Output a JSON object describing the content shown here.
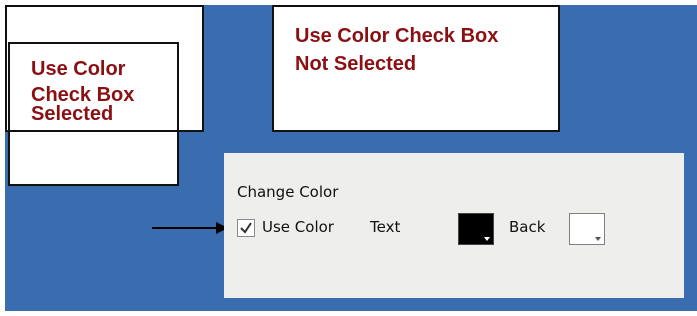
{
  "callouts": {
    "selected_line1": "Use Color",
    "selected_line2": "Check Box",
    "selected_line3": "Selected",
    "not_selected_line1": "Use Color Check Box",
    "not_selected_line2": "Not Selected"
  },
  "panel": {
    "group_title": "Change Color",
    "use_color_label": "Use Color",
    "use_color_checked": true,
    "text_label": "Text",
    "text_color": "#000000",
    "back_label": "Back",
    "back_color": "#ffffff"
  },
  "colors": {
    "background": "#3a6db0",
    "callout_text": "#8b1014",
    "panel_bg": "#eeeeec"
  }
}
